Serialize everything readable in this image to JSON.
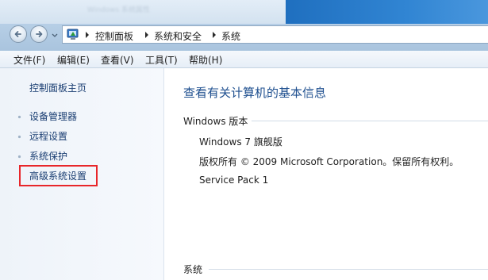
{
  "window": {
    "title_blurred": "Windows 系统属性"
  },
  "colors": {
    "accent": "#1e4f8f",
    "link": "#1a3e72",
    "highlight": "#e8262a"
  },
  "nav": {
    "back_icon": "back-arrow-icon",
    "forward_icon": "forward-arrow-icon",
    "recent_icon": "chevron-down-icon"
  },
  "breadcrumb": {
    "icon": "control-panel-icon",
    "items": [
      "控制面板",
      "系统和安全",
      "系统"
    ]
  },
  "menu": {
    "items": [
      "文件(F)",
      "编辑(E)",
      "查看(V)",
      "工具(T)",
      "帮助(H)"
    ]
  },
  "sidebar": {
    "home": "控制面板主页",
    "links": [
      "设备管理器",
      "远程设置",
      "系统保护",
      "高级系统设置"
    ]
  },
  "main": {
    "title": "查看有关计算机的基本信息",
    "windows_section": {
      "heading": "Windows 版本",
      "lines": [
        "Windows 7 旗舰版",
        "版权所有 © 2009 Microsoft Corporation。保留所有权利。",
        "Service Pack 1"
      ]
    },
    "system_section": {
      "heading": "系统"
    }
  }
}
